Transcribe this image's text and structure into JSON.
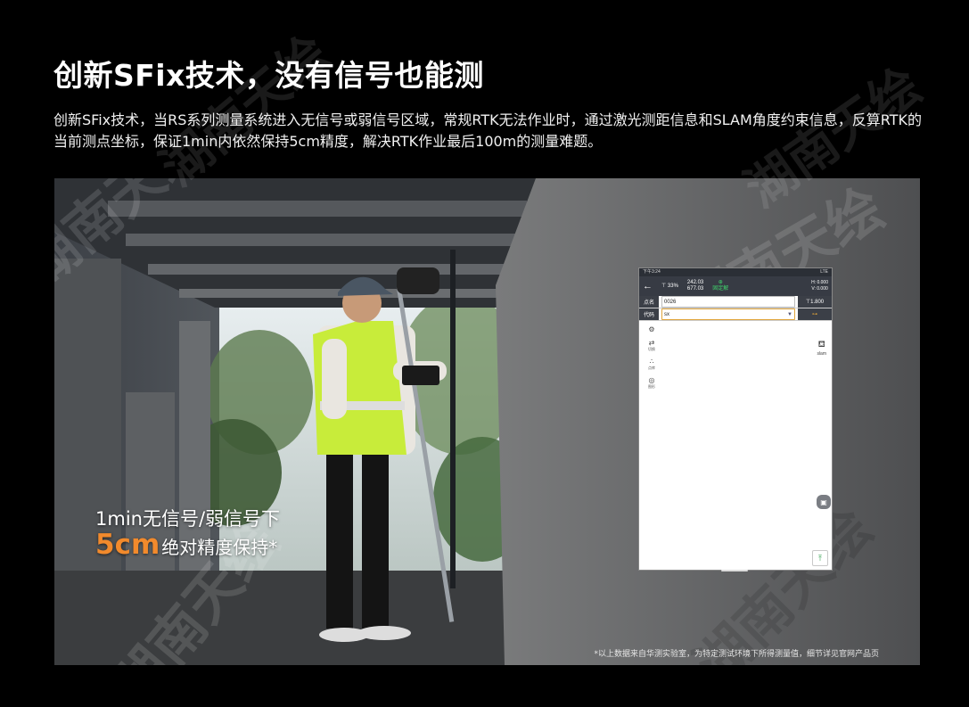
{
  "header": {
    "title": "创新SFix技术，没有信号也能测",
    "description": "创新SFix技术，当RS系列测量系统进入无信号或弱信号区域，常规RTK无法作业时，通过激光测距信息和SLAM角度约束信息，反算RTK的当前测点坐标，保证1min内依然保持5cm精度，解决RTK作业最后100m的测量难题。"
  },
  "photo": {
    "caption_line1": "1min无信号/弱信号下",
    "caption_accuracy": "5cm",
    "caption_line2": "绝对精度保持*",
    "footnote": "*以上数据来自华测实验室，为特定测试环境下所得测量值，细节详见官网产品页",
    "accent_color": "#f28a2c"
  },
  "tablet": {
    "status_time": "下午3:24",
    "status_right": "LTE",
    "toolbar": {
      "battery": "33%",
      "values_top": "242.03",
      "values_bottom": "677.03",
      "fix_status": "固定解",
      "h_value": "H: 0.000",
      "v_value": "V: 0.000"
    },
    "point_label": "点名",
    "point_value": "0026",
    "antenna_height": "1.800",
    "code_label": "代码",
    "code_value": "sx",
    "tools": [
      "切换",
      "点库",
      "图形"
    ],
    "slam_label": "slam"
  },
  "watermark": "湖南天绘"
}
